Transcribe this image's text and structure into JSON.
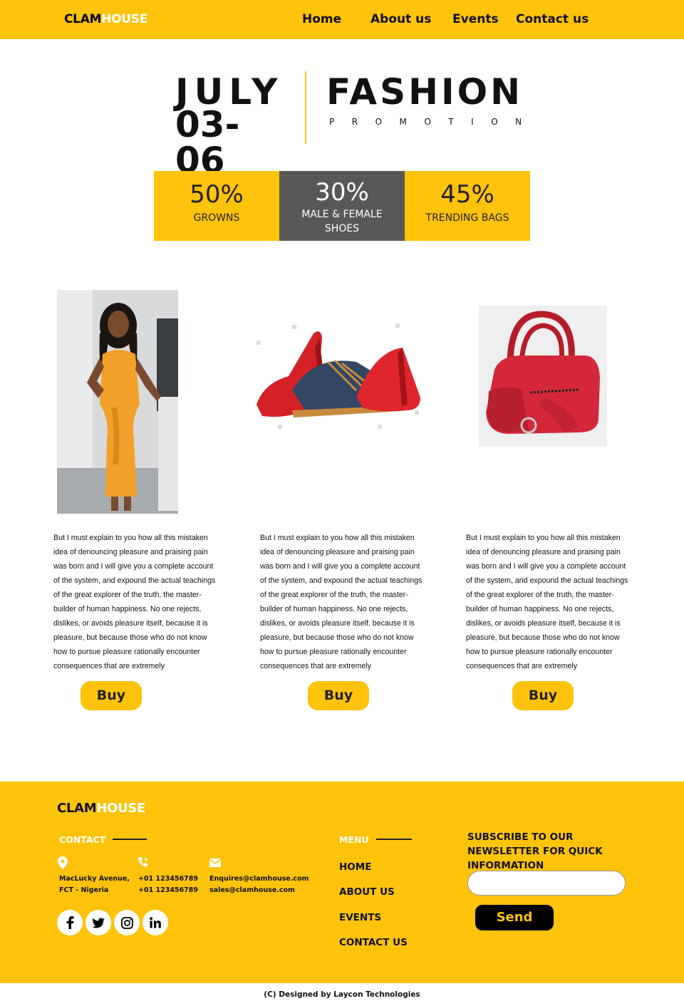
{
  "header": {
    "logo_part1": "CLAM",
    "logo_part2": "HOUSE",
    "nav": [
      "Home",
      "About us",
      "Events",
      "Contact us"
    ]
  },
  "hero": {
    "month": "JULY",
    "dates": "03-06",
    "title": "FASHION",
    "subtitle": "PROMOTION"
  },
  "promos": [
    {
      "percent": "50%",
      "label": "GROWNS"
    },
    {
      "percent": "30%",
      "label": "MALE & FEMALE SHOES"
    },
    {
      "percent": "45%",
      "label": "TRENDING BAGS"
    }
  ],
  "products": [
    {
      "description": "But I must explain to you how all this mistaken idea of denouncing pleasure and praising pain was born and I will give you a complete account of the system, and expound the actual teachings of the great explorer of the truth, the master-builder of human happiness. No one rejects, dislikes, or avoids pleasure itself, because it is pleasure, but because those who do not know how to pursue pleasure rationally encounter consequences that are extremely",
      "buy_label": "Buy"
    },
    {
      "description": "But I must explain to you how all this mistaken idea of denouncing pleasure and praising pain was born and I will give you a complete account of the system, and expound the actual teachings of the great explorer of the truth, the master-builder of human happiness. No one rejects, dislikes, or avoids pleasure itself, because it is pleasure, but because those who do not know how to pursue pleasure rationally encounter consequences that are extremely",
      "buy_label": "Buy"
    },
    {
      "description": "But I must explain to you how all this mistaken idea of denouncing pleasure and praising pain was born and I will give you a complete account of the system, and expound the actual teachings of the great explorer of the truth, the master-builder of human happiness. No one rejects, dislikes, or avoids pleasure itself, because it is pleasure, but because those who do not know how to pursue pleasure rationally encounter consequences that are extremely",
      "buy_label": "Buy"
    }
  ],
  "footer": {
    "logo_part1": "CLAM",
    "logo_part2": "HOUSE",
    "contact_heading": "CONTACT",
    "address_line1": "MacLucky Avenue,",
    "address_line2": "FCT - Nigeria",
    "phone1": "+01 123456789",
    "phone2": "+01 123456789",
    "email1": "Enquires@clamhouse.com",
    "email2": "sales@clamhouse.com",
    "icons": [
      "location-pin-icon",
      "phone-icon",
      "mail-icon"
    ],
    "social": [
      "facebook-icon",
      "twitter-icon",
      "instagram-icon",
      "linkedin-icon"
    ],
    "menu_heading": "MENU",
    "menu": [
      "HOME",
      "ABOUT US",
      "EVENTS",
      "CONTACT US"
    ],
    "newsletter_heading": "SUBSCRIBE TO OUR NEWSLETTER FOR QUICK INFORMATION",
    "newsletter_value": "",
    "send_label": "Send"
  },
  "copyright": "(C) Designed by Laycon Technologies",
  "colors": {
    "accent": "#FFC30B",
    "gray_box": "#5a5856",
    "black": "#000000"
  }
}
